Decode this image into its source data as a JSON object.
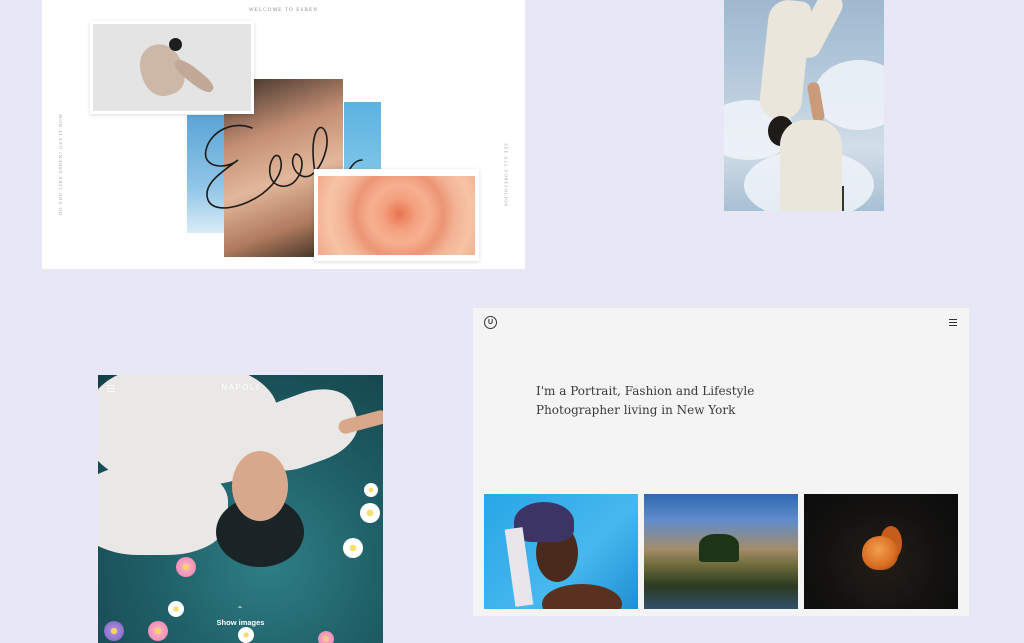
{
  "esben": {
    "welcome": "WELCOME TO ESBEN",
    "side_left": "DO YOU LIKE ESBEN? GET IT NOW",
    "side_right": "SEE ALL PORTFOLIOS"
  },
  "napoli": {
    "brand": "NAPOLI",
    "show_images": "Show images",
    "chevron": "⌃"
  },
  "portfolio": {
    "logo_letter": "U",
    "headline_line1": "I'm a Portrait, Fashion and Lifestyle",
    "headline_line2": "Photographer living in New York"
  },
  "colors": {
    "background": "#e8e7f6",
    "card_white": "#ffffff",
    "portfolio_bg": "#f4f4f4"
  },
  "icons": [
    "hamburger-menu-icon",
    "logo-icon",
    "chevron-up-icon"
  ]
}
